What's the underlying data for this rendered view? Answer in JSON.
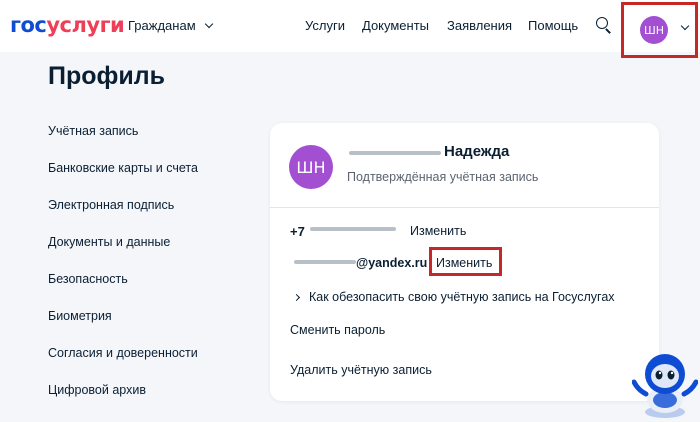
{
  "header": {
    "logo_part1": "гос",
    "logo_part2": "услуги",
    "citizens_label": "Гражданам",
    "nav": [
      "Услуги",
      "Документы",
      "Заявления",
      "Помощь"
    ],
    "avatar_initials": "ШН",
    "icons": [
      "chevron-down-icon",
      "search-icon"
    ]
  },
  "page": {
    "title": "Профиль"
  },
  "sidebar": {
    "items": [
      "Учётная запись",
      "Банковские карты и счета",
      "Электронная подпись",
      "Документы и данные",
      "Безопасность",
      "Биометрия",
      "Согласия и доверенности",
      "Цифровой архив"
    ],
    "active_index": 0
  },
  "account_card": {
    "avatar_initials": "ШН",
    "name": "Надежда",
    "status": "Подтверждённая учётная запись",
    "phone_prefix": "+7",
    "phone_change_label": "Изменить",
    "email_suffix": "@yandex.ru",
    "email_change_label": "Изменить",
    "secure_account_label": "Как обезопасить свою учётную запись на Госуслугах",
    "change_password_label": "Сменить пароль",
    "delete_account_label": "Удалить учётную запись"
  },
  "colors": {
    "brand_blue": "#0d4cd3",
    "brand_red": "#ee3f58",
    "avatar_purple": "#a34fd1",
    "highlight_red": "#c62828",
    "page_bg": "#f4f6fa"
  }
}
